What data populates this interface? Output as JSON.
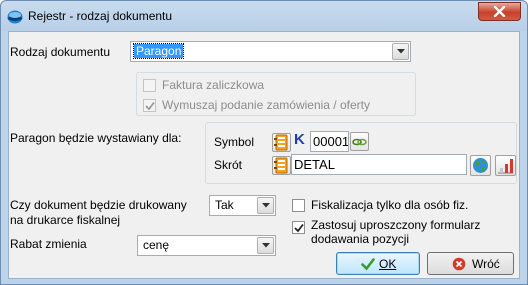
{
  "window": {
    "title": "Rejestr - rodzaj dokumentu"
  },
  "doc_type": {
    "label": "Rodzaj dokumentu",
    "value": "Paragon"
  },
  "options_group": {
    "advance_invoice": {
      "label": "Faktura zaliczkowa",
      "checked": false,
      "enabled": false
    },
    "require_order": {
      "label": "Wymuszaj podanie zamówienia / oferty",
      "checked": true,
      "enabled": false
    }
  },
  "issued_for": {
    "label": "Paragon będzie wystawiany dla:",
    "symbol_label": "Symbol",
    "symbol_value": "00001",
    "kind_letter": "K",
    "short_label": "Skrót",
    "short_value": "DETAL"
  },
  "fiscal_print": {
    "label_line1": "Czy dokument będzie drukowany",
    "label_line2": "na drukarce fiskalnej",
    "value": "Tak"
  },
  "discount": {
    "label": "Rabat zmienia",
    "value": "cenę"
  },
  "fiscal_only_individuals": {
    "label": "Fiskalizacja tylko dla osób fiz.",
    "checked": false
  },
  "simplified_form": {
    "label_line1": "Zastosuj uproszczony formularz",
    "label_line2": "dodawania pozycji",
    "checked": true
  },
  "buttons": {
    "ok_label": "OK",
    "back_label": "Wróć"
  },
  "colors": {
    "accent_selection": "#3399ff",
    "kind_letter": "#1d3fa8",
    "title_bar": "#bcd3ea",
    "close_button": "#c7402a"
  }
}
